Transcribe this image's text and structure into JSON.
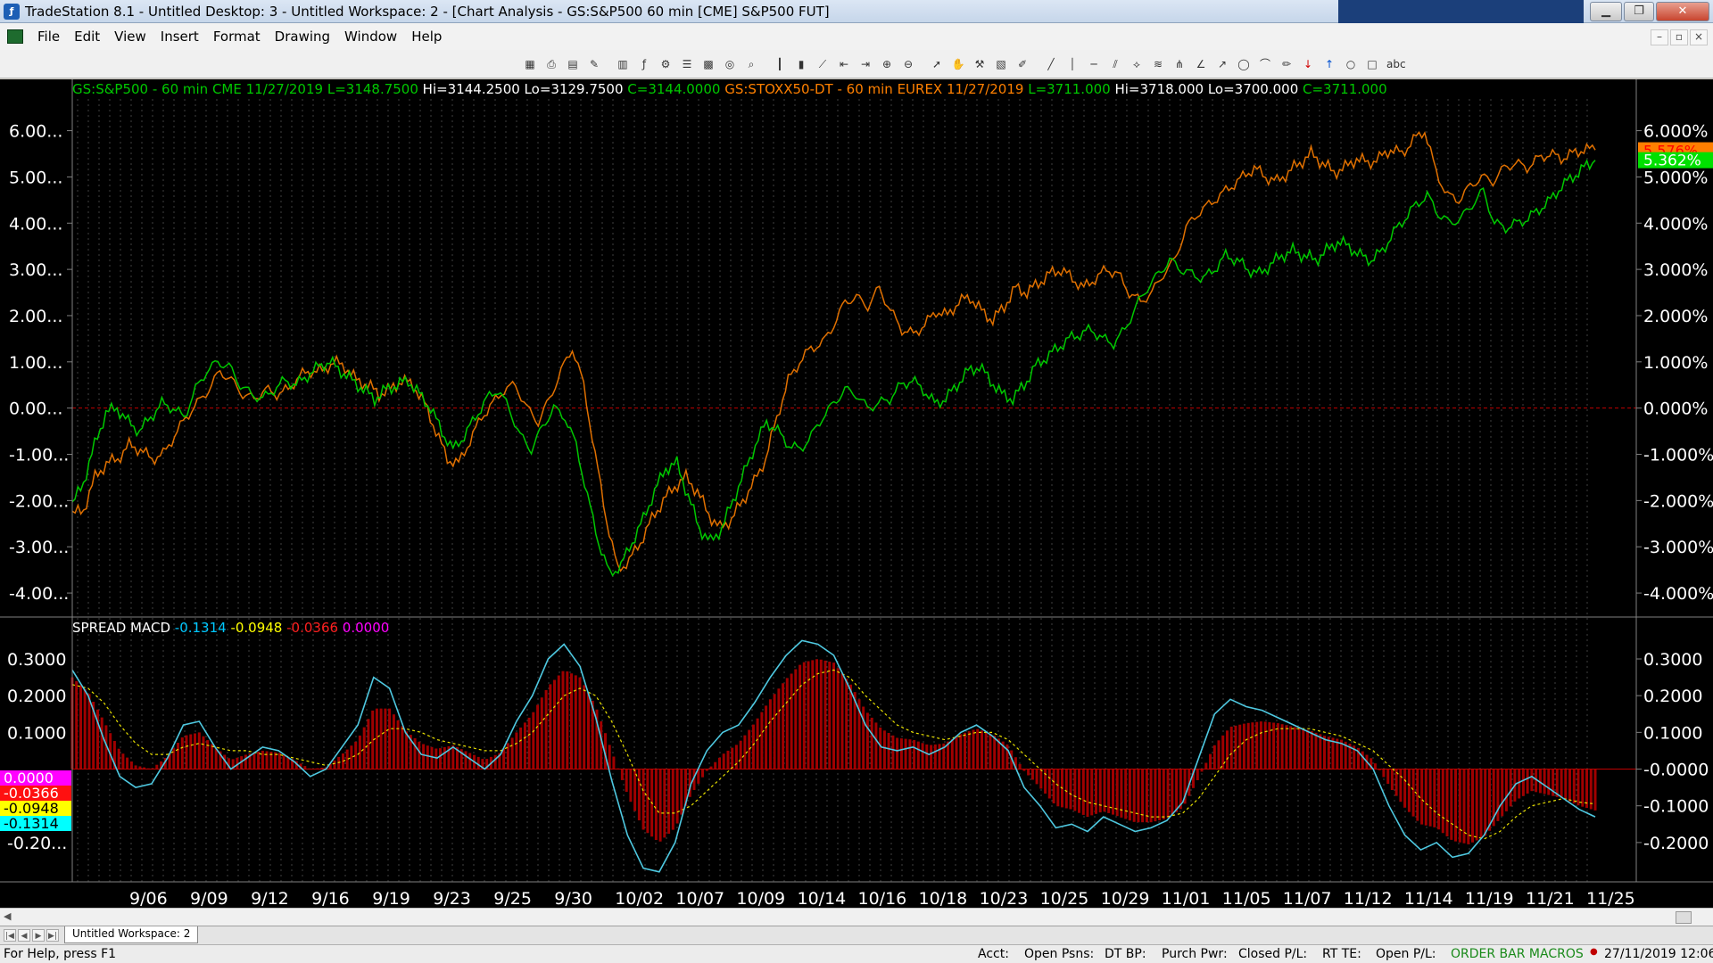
{
  "window": {
    "title": "TradeStation 8.1 - Untitled Desktop: 3 - Untitled Workspace:  2 - [Chart Analysis - GS:S&P500  60 min  [CME] S&P500 FUT]",
    "minimize": "▁",
    "maximize": "❐",
    "close": "✕"
  },
  "menu": [
    "File",
    "Edit",
    "View",
    "Insert",
    "Format",
    "Drawing",
    "Window",
    "Help"
  ],
  "mdi_controls": [
    "–",
    "▫",
    "×"
  ],
  "toolbar_icons": [
    "snapshot-icon",
    "print-icon",
    "data-window-icon",
    "style-icon",
    "bar-type-icon",
    "indicator-icon",
    "strategy-icon",
    "symbol-list-icon",
    "matrix-icon",
    "radar-icon",
    "scanner-icon",
    "bar-icon",
    "candle-icon",
    "line-icon",
    "scroll-left-icon",
    "scroll-right-icon",
    "zoom-in-icon",
    "zoom-out-icon",
    "pointer-icon",
    "pan-icon",
    "hammer-icon",
    "format-icon",
    "drawing-icon",
    "trendline-icon",
    "vertical-line-icon",
    "horizontal-line-icon",
    "channel-icon",
    "fan-icon",
    "fibonacci-icon",
    "pitchfork-icon",
    "gann-icon",
    "arrow-icon",
    "ellipse-icon",
    "arc-icon",
    "brush-icon",
    "down-arrow-icon",
    "up-arrow-icon",
    "circle-icon",
    "rectangle-icon",
    "text-icon"
  ],
  "legend_top": [
    {
      "text": "GS:S&P500 - 60 min   CME   11/27/2019",
      "color": "#00c800"
    },
    {
      "text": "L=3148.7500",
      "color": "#00c800"
    },
    {
      "text": "Hi=3144.2500   Lo=3129.7500",
      "color": "#ffffff"
    },
    {
      "text": "C=3144.0000",
      "color": "#00c800"
    },
    {
      "text": "GS:STOXX50-DT - 60 min   EUREX   11/27/2019",
      "color": "#ff8000"
    },
    {
      "text": "L=3711.000",
      "color": "#00c800"
    },
    {
      "text": "Hi=3718.000   Lo=3700.000",
      "color": "#ffffff"
    },
    {
      "text": "C=3711.000",
      "color": "#00c800"
    }
  ],
  "legend_bottom": [
    {
      "text": "SPREAD MACD",
      "color": "#ffffff"
    },
    {
      "text": "-0.1314",
      "color": "#00c8ff"
    },
    {
      "text": "-0.0948",
      "color": "#ffff00"
    },
    {
      "text": "-0.0366",
      "color": "#ff2020"
    },
    {
      "text": "0.0000",
      "color": "#ff00ff"
    }
  ],
  "colors": {
    "sp500": "#00c800",
    "stoxx": "#e07000",
    "macd": "#4ec8e0",
    "signal": "#e8e000",
    "hist": "#a00000",
    "zero": "#c00000",
    "grid": "#808080",
    "axis_text": "#ffffff"
  },
  "chart_data": [
    {
      "type": "line",
      "title": "",
      "y_ticks_left": [
        "6.00...",
        "5.00...",
        "4.00...",
        "3.00...",
        "2.00...",
        "1.00...",
        "0.00...",
        "-1.00...",
        "-2.00...",
        "-3.00...",
        "-4.00..."
      ],
      "y_ticks_right": [
        "6.000%",
        "5.000%",
        "4.000%",
        "3.000%",
        "2.000%",
        "1.000%",
        "0.000%",
        "-1.000%",
        "-2.000%",
        "-3.000%",
        "-4.000%"
      ],
      "ylim": [
        -4.5,
        6.3
      ],
      "last_values": {
        "stoxx": "5.576%",
        "sp500": "5.362%"
      },
      "x_labels": [
        "9/06",
        "9/09",
        "9/12",
        "9/16",
        "9/19",
        "9/23",
        "9/25",
        "9/30",
        "10/02",
        "10/07",
        "10/09",
        "10/14",
        "10/16",
        "10/18",
        "10/23",
        "10/25",
        "10/29",
        "11/01",
        "11/05",
        "11/07",
        "11/12",
        "11/14",
        "11/19",
        "11/21",
        "11/25"
      ],
      "series": [
        {
          "name": "GS:S&P500 - 60 min",
          "values": [
            -2.1,
            -1.6,
            -0.8,
            -0.1,
            0.0,
            -0.3,
            -0.5,
            -0.2,
            0.1,
            0.0,
            -0.2,
            0.4,
            0.8,
            1.0,
            0.9,
            0.5,
            0.3,
            0.2,
            0.4,
            0.6,
            0.5,
            0.7,
            0.9,
            1.0,
            0.8,
            0.6,
            0.4,
            0.2,
            0.4,
            0.5,
            0.6,
            0.3,
            0.0,
            -0.5,
            -0.9,
            -0.6,
            -0.2,
            0.2,
            0.4,
            0.0,
            -0.6,
            -0.9,
            -0.4,
            0.0,
            -0.2,
            -0.8,
            -1.9,
            -2.9,
            -3.6,
            -3.4,
            -2.9,
            -2.4,
            -1.8,
            -1.3,
            -1.2,
            -1.9,
            -2.6,
            -2.9,
            -2.6,
            -2.0,
            -1.4,
            -0.8,
            -0.3,
            -0.5,
            -0.8,
            -0.9,
            -0.6,
            -0.2,
            0.1,
            0.4,
            0.3,
            0.0,
            0.1,
            0.2,
            0.5,
            0.6,
            0.4,
            0.1,
            0.2,
            0.5,
            0.8,
            0.9,
            0.6,
            0.3,
            0.2,
            0.5,
            0.9,
            1.1,
            1.3,
            1.5,
            1.6,
            1.7,
            1.5,
            1.4,
            1.7,
            2.2,
            2.6,
            2.9,
            3.2,
            3.0,
            2.9,
            2.8,
            3.0,
            3.3,
            3.2,
            3.0,
            2.9,
            3.1,
            3.3,
            3.4,
            3.3,
            3.2,
            3.4,
            3.6,
            3.5,
            3.3,
            3.2,
            3.4,
            3.8,
            4.1,
            4.4,
            4.6,
            4.2,
            4.0,
            4.1,
            4.4,
            4.7,
            4.0,
            3.9,
            4.0,
            4.1,
            4.3,
            4.5,
            4.8,
            5.0,
            5.2,
            5.36
          ]
        },
        {
          "name": "GS:STOXX50-DT - 60 min",
          "values": [
            -2.3,
            -2.2,
            -1.5,
            -1.2,
            -1.1,
            -0.8,
            -0.9,
            -1.1,
            -1.0,
            -0.6,
            -0.2,
            0.1,
            0.4,
            0.8,
            0.6,
            0.3,
            0.2,
            0.4,
            0.3,
            0.4,
            0.7,
            0.8,
            0.8,
            1.0,
            0.9,
            0.6,
            0.5,
            0.3,
            0.4,
            0.6,
            0.5,
            0.1,
            -0.5,
            -1.1,
            -1.2,
            -0.7,
            -0.2,
            0.1,
            0.4,
            0.5,
            0.0,
            -0.3,
            0.2,
            0.8,
            1.3,
            0.5,
            -1.0,
            -2.4,
            -3.5,
            -3.3,
            -2.9,
            -2.4,
            -2.0,
            -1.7,
            -1.5,
            -1.8,
            -2.3,
            -2.6,
            -2.4,
            -2.0,
            -1.6,
            -1.1,
            -0.2,
            0.6,
            1.0,
            1.3,
            1.4,
            1.8,
            2.3,
            2.4,
            2.2,
            2.6,
            2.1,
            1.7,
            1.6,
            1.8,
            2.1,
            2.0,
            2.3,
            2.4,
            2.1,
            1.9,
            2.2,
            2.6,
            2.5,
            2.7,
            2.9,
            3.0,
            2.8,
            2.6,
            2.8,
            3.0,
            2.9,
            2.5,
            2.3,
            2.5,
            2.9,
            3.2,
            3.9,
            4.2,
            4.4,
            4.6,
            4.8,
            5.0,
            5.2,
            5.0,
            4.9,
            5.1,
            5.3,
            5.5,
            5.3,
            5.1,
            5.2,
            5.4,
            5.3,
            5.4,
            5.6,
            5.5,
            5.8,
            6.0,
            5.1,
            4.6,
            4.5,
            4.8,
            5.0,
            4.9,
            5.2,
            5.3,
            5.2,
            5.4,
            5.5,
            5.4,
            5.5,
            5.6,
            5.58
          ]
        }
      ]
    },
    {
      "type": "line",
      "title": "SPREAD MACD",
      "y_ticks_left": [
        "0.3000",
        "0.2000",
        "0.1000",
        "-0.20..."
      ],
      "y_ticks_right": [
        "0.3000",
        "0.2000",
        "0.1000",
        "-0.0000",
        "-0.1000",
        "-0.2000"
      ],
      "ylim": [
        -0.295,
        0.385
      ],
      "last_values": {
        "zero": "0.0000",
        "hist": "-0.0366",
        "signal": "-0.0948",
        "macd": "-0.1314"
      },
      "series": [
        {
          "name": "MACD",
          "values": [
            0.27,
            0.2,
            0.08,
            -0.02,
            -0.05,
            -0.04,
            0.03,
            0.12,
            0.13,
            0.06,
            0.0,
            0.03,
            0.06,
            0.05,
            0.02,
            -0.02,
            0.0,
            0.06,
            0.12,
            0.25,
            0.22,
            0.1,
            0.04,
            0.03,
            0.06,
            0.03,
            0.0,
            0.04,
            0.13,
            0.2,
            0.3,
            0.34,
            0.28,
            0.14,
            -0.03,
            -0.18,
            -0.27,
            -0.28,
            -0.2,
            -0.04,
            0.05,
            0.1,
            0.12,
            0.18,
            0.25,
            0.31,
            0.35,
            0.34,
            0.31,
            0.22,
            0.12,
            0.06,
            0.05,
            0.06,
            0.04,
            0.06,
            0.1,
            0.12,
            0.09,
            0.05,
            -0.05,
            -0.1,
            -0.16,
            -0.15,
            -0.17,
            -0.13,
            -0.15,
            -0.17,
            -0.16,
            -0.14,
            -0.09,
            0.03,
            0.15,
            0.19,
            0.17,
            0.16,
            0.14,
            0.12,
            0.1,
            0.08,
            0.07,
            0.05,
            0.0,
            -0.1,
            -0.18,
            -0.22,
            -0.2,
            -0.24,
            -0.23,
            -0.18,
            -0.1,
            -0.04,
            -0.02,
            -0.05,
            -0.08,
            -0.11,
            -0.13
          ]
        },
        {
          "name": "Signal",
          "values": [
            0.23,
            0.22,
            0.18,
            0.12,
            0.07,
            0.04,
            0.04,
            0.06,
            0.07,
            0.06,
            0.05,
            0.05,
            0.04,
            0.04,
            0.03,
            0.02,
            0.01,
            0.02,
            0.04,
            0.08,
            0.11,
            0.11,
            0.1,
            0.08,
            0.07,
            0.06,
            0.05,
            0.05,
            0.07,
            0.1,
            0.15,
            0.2,
            0.22,
            0.2,
            0.13,
            0.04,
            -0.06,
            -0.12,
            -0.12,
            -0.1,
            -0.06,
            -0.02,
            0.02,
            0.07,
            0.13,
            0.18,
            0.23,
            0.26,
            0.27,
            0.25,
            0.2,
            0.16,
            0.12,
            0.1,
            0.09,
            0.08,
            0.09,
            0.1,
            0.1,
            0.08,
            0.04,
            0.0,
            -0.04,
            -0.07,
            -0.09,
            -0.1,
            -0.11,
            -0.12,
            -0.13,
            -0.13,
            -0.12,
            -0.08,
            -0.02,
            0.04,
            0.08,
            0.1,
            0.11,
            0.11,
            0.11,
            0.1,
            0.09,
            0.07,
            0.05,
            0.01,
            -0.03,
            -0.08,
            -0.12,
            -0.15,
            -0.18,
            -0.19,
            -0.17,
            -0.13,
            -0.1,
            -0.09,
            -0.08,
            -0.09,
            -0.095
          ]
        }
      ]
    }
  ],
  "tabs": {
    "active": "Untitled Workspace:  2"
  },
  "status": {
    "help": "For Help, press F1",
    "acct": "Acct:",
    "open_psns": "Open Psns:",
    "dt_bp": "DT BP:",
    "purch_pwr": "Purch Pwr:",
    "closed_pl": "Closed P/L:",
    "rt_te": "RT TE:",
    "open_pl": "Open P/L:",
    "order_bar": "ORDER BAR  MACROS",
    "datetime": "27/11/2019 12:06"
  }
}
